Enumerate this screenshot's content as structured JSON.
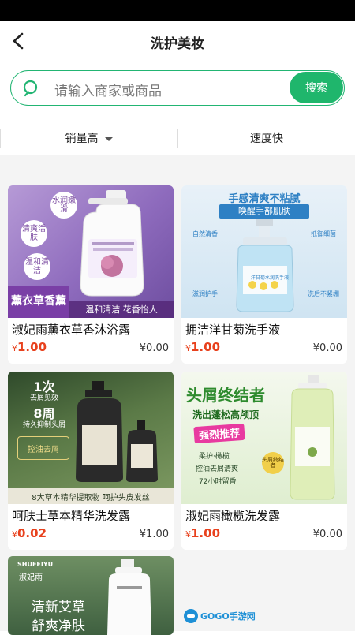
{
  "header": {
    "title": "洗护美妆"
  },
  "search": {
    "placeholder": "请输入商家或商品",
    "button": "搜索"
  },
  "sort": {
    "sales": "销量高",
    "speed": "速度快"
  },
  "products": [
    {
      "name": "淑妃雨薰衣草香沐浴露",
      "price": "1.00",
      "orig": "¥0.00",
      "badges": [
        "水润嫩滑",
        "清爽活肤",
        "温和清洁"
      ],
      "tag": "薰衣草香薰",
      "strip": "温和清洁 花香怡人"
    },
    {
      "name": "拥洁洋甘菊洗手液",
      "price": "1.00",
      "orig": "¥0.00",
      "headline1": "手感清爽不粘腻",
      "headline2": "唤醒手部肌肤",
      "features": [
        "自然清香",
        "抵御细菌",
        "滋润护手",
        "洗后不紧绷"
      ],
      "bottle_label": "洋甘菊水润洗手液"
    },
    {
      "name": "呵肤士草本精华洗发露",
      "price": "0.02",
      "orig": "¥1.00",
      "claim1": "1次",
      "claim1b": "去屑见效",
      "claim2": "8周",
      "claim2b": "持久抑制头屑",
      "stamp": "控油去屑",
      "strip": "8大草本精华提取物  呵护头皮发丝"
    },
    {
      "name": "淑妃雨橄榄洗发露",
      "price": "1.00",
      "orig": "¥0.00",
      "headline": "头屑终结者",
      "sub": "洗出蓬松高颅顶",
      "promo": "强烈推荐",
      "line1": "柔护·橄榄",
      "line2": "控油去屑清爽",
      "line3": "72小时留香",
      "seal": "头屑终结者"
    },
    {
      "brand": "SHUFEIYU",
      "brand_cn": "淑妃雨",
      "text1": "清新艾草",
      "text2": "舒爽净肤"
    }
  ],
  "watermark": {
    "text": "GOGO手游网"
  },
  "colors": {
    "accent": "#1fb66c",
    "price": "#e8411d"
  }
}
